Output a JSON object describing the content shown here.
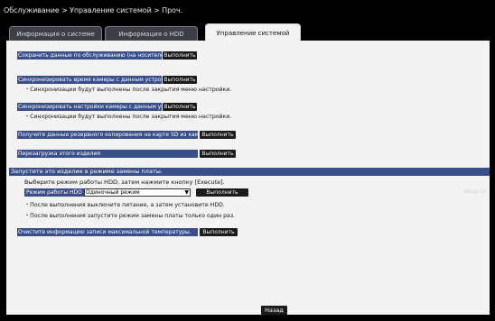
{
  "breadcrumb": "Обслуживание > Управление системой > Проч.",
  "tabs": [
    {
      "label": "Информация о системе"
    },
    {
      "label": "Информация о HDD"
    },
    {
      "label": "Управление системой"
    }
  ],
  "actions": {
    "save_data": {
      "label": "Сохранить данные по обслуживанию (на носителе USB)",
      "button": "Выполнить"
    },
    "sync_time": {
      "label": "Синхронизировать время камеры с данным устройством",
      "button": "Выполнить",
      "note": "・Синхронизации будут выполнены после закрытия меню настройки."
    },
    "sync_settings": {
      "label": "Синхронизировать настройки камеры с данным устройством",
      "button": "Выполнить",
      "note": "・Синхронизации будут выполнены после закрытия меню настройки."
    },
    "backup_sd": {
      "label": "Получите данные резервного копирования на карте SD из камеры.",
      "button": "Выполнить"
    },
    "reboot": {
      "label": "Перезагрузка этого изделия",
      "button": "Выполнить"
    },
    "clear_temp": {
      "label": "Очистите информацию записи максимальной температуры.",
      "button": "Выполнить"
    }
  },
  "board_replace": {
    "heading": "Запустите это изделие в режиме замены платы.",
    "instruction": "Выберите режим работы HDD, затем нажмите кнопку [Execute].",
    "mode_label": "Режим работы HDD",
    "mode_value": "Одиночный режим",
    "button": "Выполнить",
    "note1": "・После выполнения выключите питание, а затем установите HDD.",
    "note2": "・После выполнения запустите режим замены платы только один раз."
  },
  "watermark": "setup.ru",
  "back_button": "Назад"
}
